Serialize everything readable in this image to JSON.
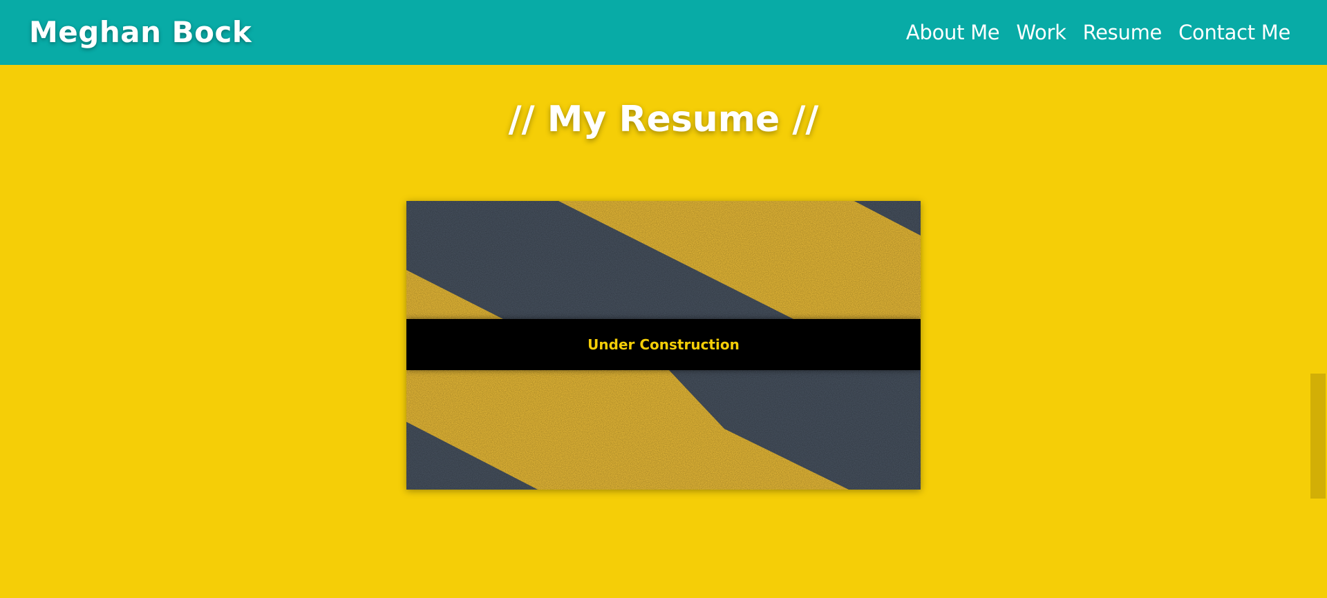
{
  "header": {
    "brand": "Meghan Bock",
    "nav": [
      {
        "label": "About Me"
      },
      {
        "label": "Work"
      },
      {
        "label": "Resume"
      },
      {
        "label": "Contact Me"
      }
    ]
  },
  "main": {
    "title": "// My Resume //",
    "card": {
      "banner_text": "Under Construction",
      "image": "yellow-black-hazard-stripes-asphalt"
    }
  },
  "colors": {
    "header_bg": "#08aba6",
    "page_bg": "#f5ce07",
    "banner_bg": "#000000",
    "banner_text": "#f5ce07"
  }
}
